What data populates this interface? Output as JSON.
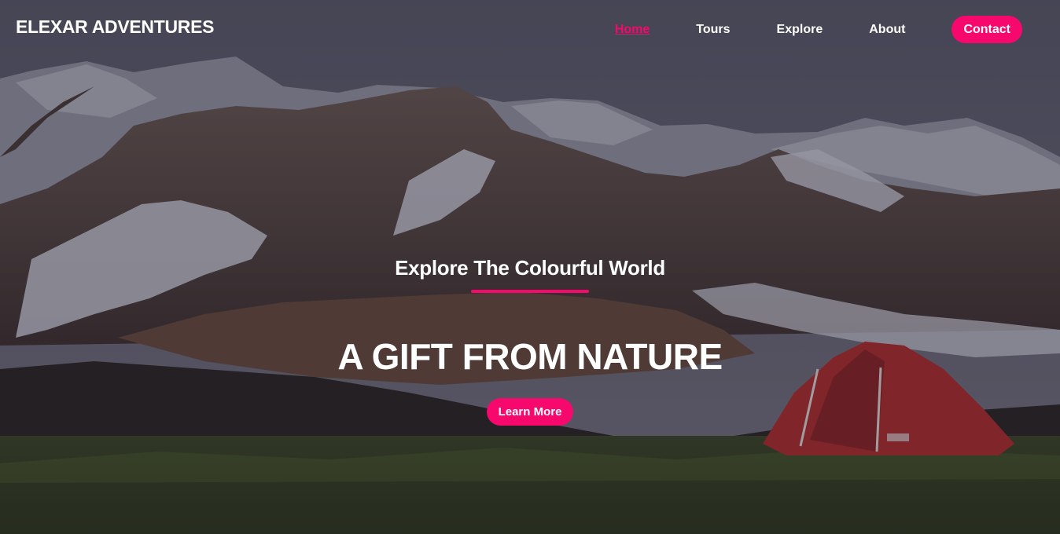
{
  "brand": {
    "name": "ELEXAR ADVENTURES"
  },
  "nav": {
    "items": [
      {
        "label": "Home",
        "active": true
      },
      {
        "label": "Tours",
        "active": false
      },
      {
        "label": "Explore",
        "active": false
      },
      {
        "label": "About",
        "active": false
      }
    ],
    "contact_label": "Contact"
  },
  "hero": {
    "subtitle": "Explore The Colourful World",
    "headline": "A GIFT FROM NATURE",
    "cta_label": "Learn More",
    "background": "mountains-camping-tent-photo"
  },
  "colors": {
    "accent": "#f6086d",
    "text": "#ffffff",
    "tent": "#c2302c",
    "grass": "#3f4a1f"
  }
}
